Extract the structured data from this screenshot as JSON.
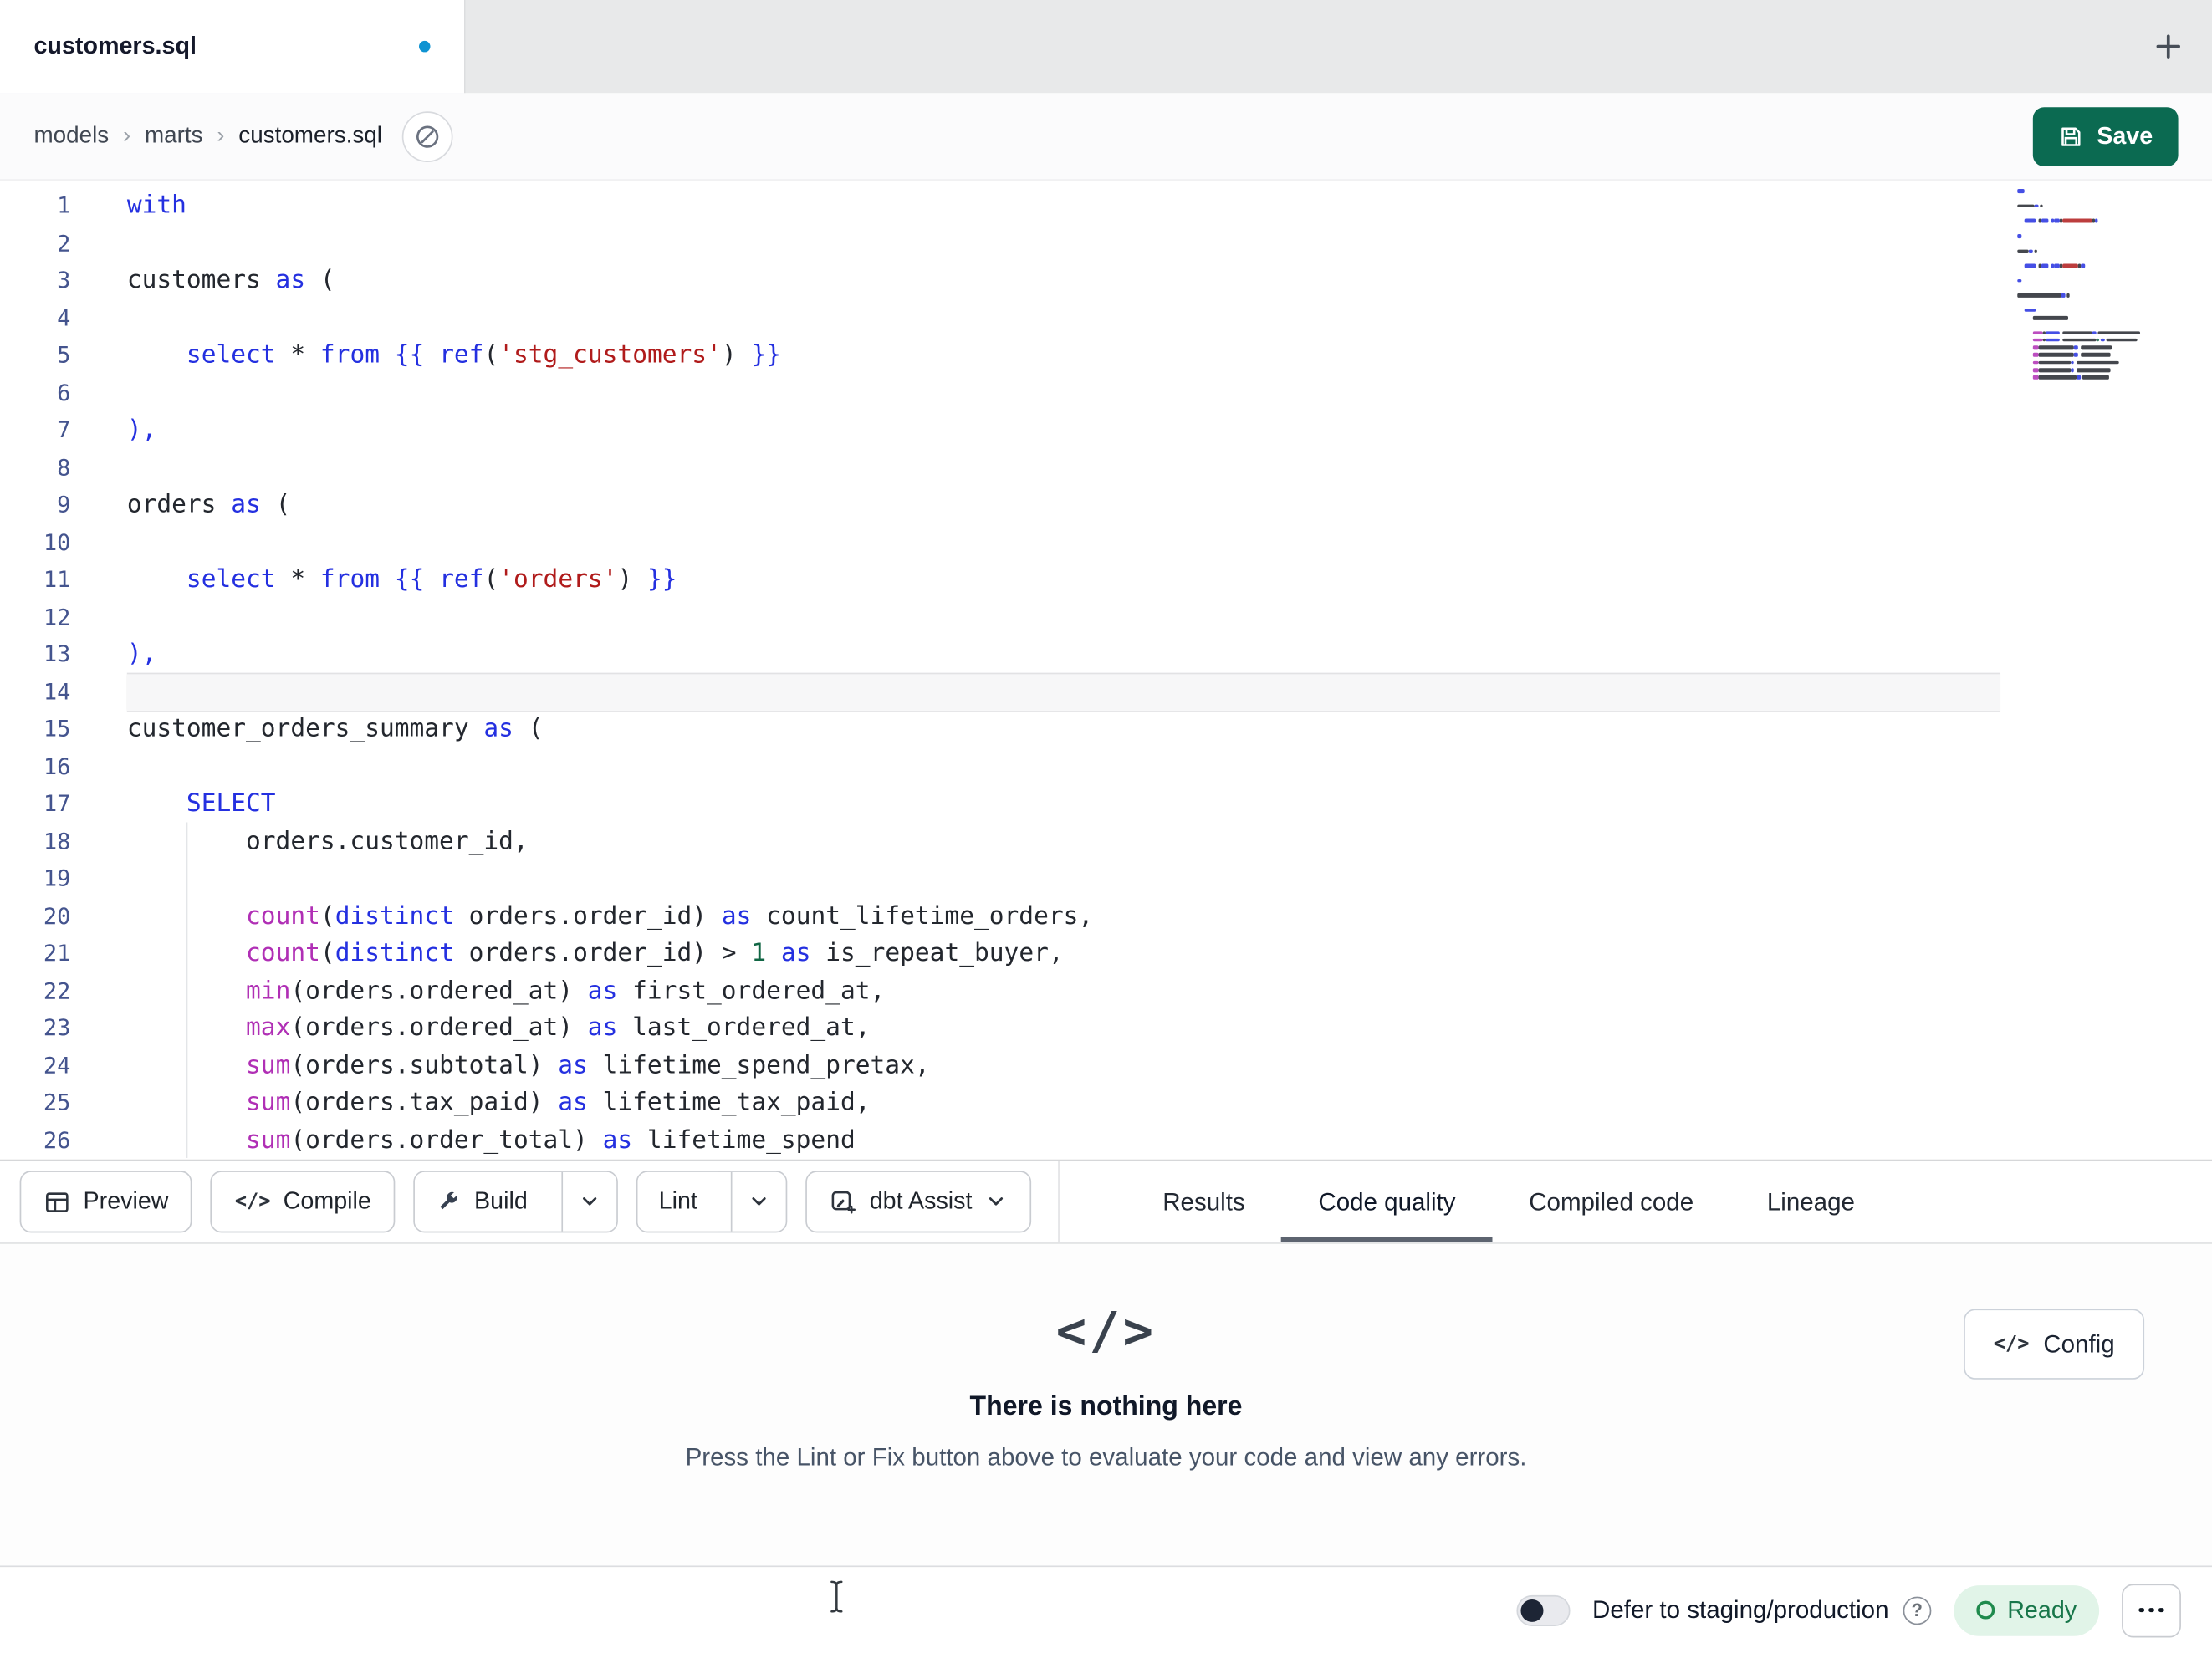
{
  "window": {
    "title": "customers.sql"
  },
  "tab_bar": {
    "active_tab_label": "customers.sql",
    "unsaved_indicator": true
  },
  "breadcrumb": {
    "items": [
      "models",
      "marts",
      "customers.sql"
    ],
    "separator": "›"
  },
  "header": {
    "save_label": "Save"
  },
  "editor": {
    "language": "sql",
    "active_line": 14,
    "gutter_color": "#44548e",
    "token_colors": {
      "kw": "#2430e0",
      "fn": "#b02fb5",
      "str": "#b01b1b",
      "num": "#116644",
      "pl": "#23272e",
      "jj": "#2430e0",
      "pb": "#2430e0"
    },
    "lines": [
      {
        "n": 1,
        "t": [
          [
            "kw",
            "with"
          ]
        ]
      },
      {
        "n": 2,
        "t": []
      },
      {
        "n": 3,
        "t": [
          [
            "pl",
            "customers "
          ],
          [
            "kw",
            "as"
          ],
          [
            "pl",
            " ("
          ]
        ]
      },
      {
        "n": 4,
        "t": []
      },
      {
        "n": 5,
        "t": [
          [
            "pl",
            "    "
          ],
          [
            "kw",
            "select"
          ],
          [
            "pl",
            " * "
          ],
          [
            "kw",
            "from"
          ],
          [
            "pl",
            " "
          ],
          [
            "jj",
            "{{ "
          ],
          [
            "kw",
            "ref"
          ],
          [
            "pl",
            "("
          ],
          [
            "str",
            "'stg_customers'"
          ],
          [
            "pl",
            ") "
          ],
          [
            "jj",
            "}}"
          ]
        ]
      },
      {
        "n": 6,
        "t": []
      },
      {
        "n": 7,
        "t": [
          [
            "pb",
            "),"
          ]
        ]
      },
      {
        "n": 8,
        "t": []
      },
      {
        "n": 9,
        "t": [
          [
            "pl",
            "orders "
          ],
          [
            "kw",
            "as"
          ],
          [
            "pl",
            " ("
          ]
        ]
      },
      {
        "n": 10,
        "t": []
      },
      {
        "n": 11,
        "t": [
          [
            "pl",
            "    "
          ],
          [
            "kw",
            "select"
          ],
          [
            "pl",
            " * "
          ],
          [
            "kw",
            "from"
          ],
          [
            "pl",
            " "
          ],
          [
            "jj",
            "{{ "
          ],
          [
            "kw",
            "ref"
          ],
          [
            "pl",
            "("
          ],
          [
            "str",
            "'orders'"
          ],
          [
            "pl",
            ") "
          ],
          [
            "jj",
            "}}"
          ]
        ]
      },
      {
        "n": 12,
        "t": []
      },
      {
        "n": 13,
        "t": [
          [
            "pb",
            "),"
          ]
        ]
      },
      {
        "n": 14,
        "t": []
      },
      {
        "n": 15,
        "t": [
          [
            "pl",
            "customer_orders_summary "
          ],
          [
            "kw",
            "as"
          ],
          [
            "pl",
            " ("
          ]
        ]
      },
      {
        "n": 16,
        "t": []
      },
      {
        "n": 17,
        "t": [
          [
            "pl",
            "    "
          ],
          [
            "kw",
            "SELECT"
          ]
        ]
      },
      {
        "n": 18,
        "t": [
          [
            "pl",
            "        orders.customer_id,"
          ]
        ]
      },
      {
        "n": 19,
        "t": []
      },
      {
        "n": 20,
        "t": [
          [
            "pl",
            "        "
          ],
          [
            "fn",
            "count"
          ],
          [
            "pl",
            "("
          ],
          [
            "kw",
            "distinct"
          ],
          [
            "pl",
            " orders.order_id) "
          ],
          [
            "kw",
            "as"
          ],
          [
            "pl",
            " count_lifetime_orders,"
          ]
        ]
      },
      {
        "n": 21,
        "t": [
          [
            "pl",
            "        "
          ],
          [
            "fn",
            "count"
          ],
          [
            "pl",
            "("
          ],
          [
            "kw",
            "distinct"
          ],
          [
            "pl",
            " orders.order_id) > "
          ],
          [
            "num",
            "1"
          ],
          [
            "pl",
            " "
          ],
          [
            "kw",
            "as"
          ],
          [
            "pl",
            " is_repeat_buyer,"
          ]
        ]
      },
      {
        "n": 22,
        "t": [
          [
            "pl",
            "        "
          ],
          [
            "fn",
            "min"
          ],
          [
            "pl",
            "(orders.ordered_at) "
          ],
          [
            "kw",
            "as"
          ],
          [
            "pl",
            " first_ordered_at,"
          ]
        ]
      },
      {
        "n": 23,
        "t": [
          [
            "pl",
            "        "
          ],
          [
            "fn",
            "max"
          ],
          [
            "pl",
            "(orders.ordered_at) "
          ],
          [
            "kw",
            "as"
          ],
          [
            "pl",
            " last_ordered_at,"
          ]
        ]
      },
      {
        "n": 24,
        "t": [
          [
            "pl",
            "        "
          ],
          [
            "fn",
            "sum"
          ],
          [
            "pl",
            "(orders.subtotal) "
          ],
          [
            "kw",
            "as"
          ],
          [
            "pl",
            " lifetime_spend_pretax,"
          ]
        ]
      },
      {
        "n": 25,
        "t": [
          [
            "pl",
            "        "
          ],
          [
            "fn",
            "sum"
          ],
          [
            "pl",
            "(orders.tax_paid) "
          ],
          [
            "kw",
            "as"
          ],
          [
            "pl",
            " lifetime_tax_paid,"
          ]
        ]
      },
      {
        "n": 26,
        "t": [
          [
            "pl",
            "        "
          ],
          [
            "fn",
            "sum"
          ],
          [
            "pl",
            "(orders.order_total) "
          ],
          [
            "kw",
            "as"
          ],
          [
            "pl",
            " lifetime_spend"
          ]
        ]
      }
    ]
  },
  "toolbar": {
    "preview_label": "Preview",
    "compile_label": "Compile",
    "compile_icon": "</>",
    "build_label": "Build",
    "lint_label": "Lint",
    "assist_label": "dbt Assist",
    "tabs": [
      {
        "label": "Results",
        "active": false
      },
      {
        "label": "Code quality",
        "active": true
      },
      {
        "label": "Compiled code",
        "active": false
      },
      {
        "label": "Lineage",
        "active": false
      }
    ]
  },
  "empty_state": {
    "icon": "</>",
    "title": "There is nothing here",
    "subtitle": "Press the Lint or Fix button above to evaluate your code and view any errors.",
    "config_label": "Config"
  },
  "status_bar": {
    "defer_label": "Defer to staging/production",
    "help_glyph": "?",
    "ready_label": "Ready"
  },
  "colors": {
    "save_button_green": "#0b6a51",
    "unsaved_dot_blue": "#0f93d2",
    "ready_text_green": "#18764a",
    "ready_bg_green": "#e1f4e8",
    "active_tab_underline": "#5d6470"
  }
}
